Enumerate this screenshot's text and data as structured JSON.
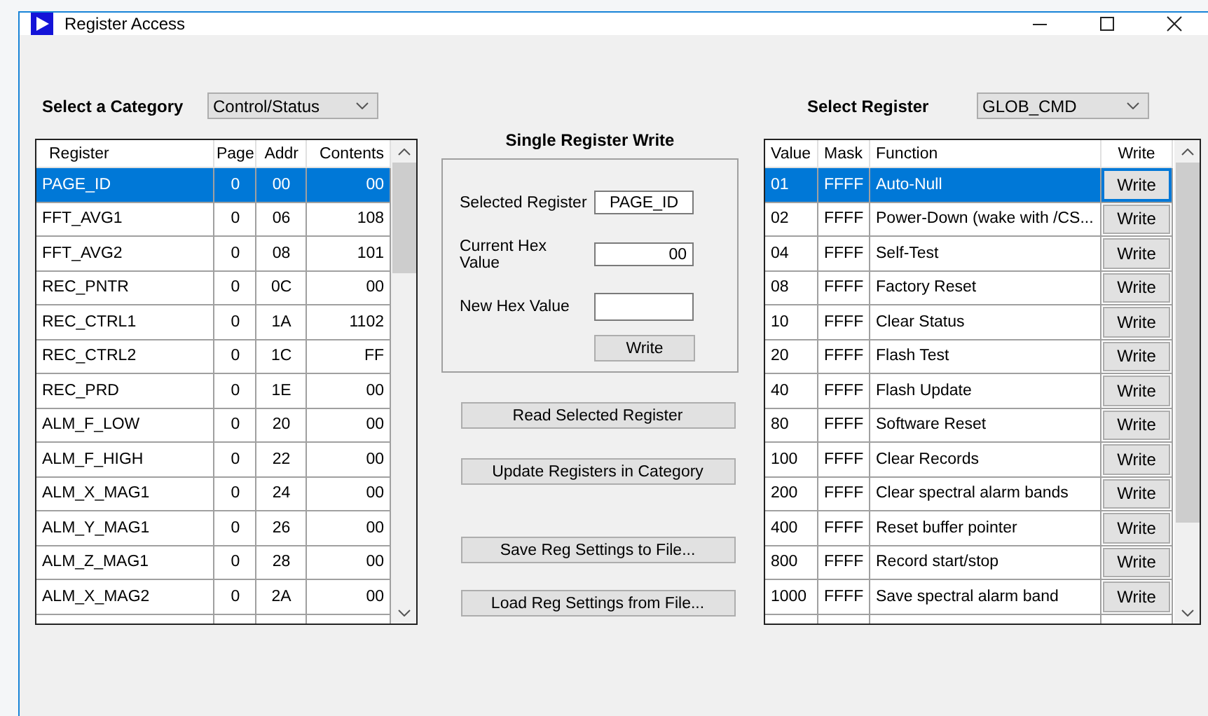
{
  "window": {
    "title": "Register Access"
  },
  "category": {
    "label": "Select a Category",
    "value": "Control/Status"
  },
  "registers": {
    "columns": [
      "Register",
      "Page",
      "Addr",
      "Contents"
    ],
    "rows": [
      {
        "register": "PAGE_ID",
        "page": "0",
        "addr": "00",
        "contents": "00",
        "selected": true
      },
      {
        "register": "FFT_AVG1",
        "page": "0",
        "addr": "06",
        "contents": "108",
        "selected": false
      },
      {
        "register": "FFT_AVG2",
        "page": "0",
        "addr": "08",
        "contents": "101",
        "selected": false
      },
      {
        "register": "REC_PNTR",
        "page": "0",
        "addr": "0C",
        "contents": "00",
        "selected": false
      },
      {
        "register": "REC_CTRL1",
        "page": "0",
        "addr": "1A",
        "contents": "1102",
        "selected": false
      },
      {
        "register": "REC_CTRL2",
        "page": "0",
        "addr": "1C",
        "contents": "FF",
        "selected": false
      },
      {
        "register": "REC_PRD",
        "page": "0",
        "addr": "1E",
        "contents": "00",
        "selected": false
      },
      {
        "register": "ALM_F_LOW",
        "page": "0",
        "addr": "20",
        "contents": "00",
        "selected": false
      },
      {
        "register": "ALM_F_HIGH",
        "page": "0",
        "addr": "22",
        "contents": "00",
        "selected": false
      },
      {
        "register": "ALM_X_MAG1",
        "page": "0",
        "addr": "24",
        "contents": "00",
        "selected": false
      },
      {
        "register": "ALM_Y_MAG1",
        "page": "0",
        "addr": "26",
        "contents": "00",
        "selected": false
      },
      {
        "register": "ALM_Z_MAG1",
        "page": "0",
        "addr": "28",
        "contents": "00",
        "selected": false
      },
      {
        "register": "ALM_X_MAG2",
        "page": "0",
        "addr": "2A",
        "contents": "00",
        "selected": false
      }
    ]
  },
  "single_write": {
    "title": "Single Register Write",
    "fields": [
      {
        "label": "Selected Register",
        "value": "PAGE_ID"
      },
      {
        "label": "Current Hex Value",
        "value": "00"
      },
      {
        "label": "New Hex Value"
      }
    ],
    "button": "Write"
  },
  "actions": [
    "Read Selected Register",
    "Update Registers in Category",
    "Save Reg Settings to File...",
    "Load Reg Settings from File..."
  ],
  "select_register": {
    "label": "Select Register",
    "value": "GLOB_CMD"
  },
  "functions": {
    "columns": [
      "Value",
      "Mask",
      "Function",
      "Write"
    ],
    "rows": [
      {
        "value": "01",
        "mask": "FFFF",
        "function": "Auto-Null",
        "button": "Write",
        "selected": true
      },
      {
        "value": "02",
        "mask": "FFFF",
        "function": "Power-Down (wake with /CS...",
        "button": "Write",
        "selected": false
      },
      {
        "value": "04",
        "mask": "FFFF",
        "function": "Self-Test",
        "button": "Write",
        "selected": false
      },
      {
        "value": "08",
        "mask": "FFFF",
        "function": "Factory Reset",
        "button": "Write",
        "selected": false
      },
      {
        "value": "10",
        "mask": "FFFF",
        "function": "Clear Status",
        "button": "Write",
        "selected": false
      },
      {
        "value": "20",
        "mask": "FFFF",
        "function": "Flash Test",
        "button": "Write",
        "selected": false
      },
      {
        "value": "40",
        "mask": "FFFF",
        "function": "Flash Update",
        "button": "Write",
        "selected": false
      },
      {
        "value": "80",
        "mask": "FFFF",
        "function": "Software Reset",
        "button": "Write",
        "selected": false
      },
      {
        "value": "100",
        "mask": "FFFF",
        "function": "Clear Records",
        "button": "Write",
        "selected": false
      },
      {
        "value": "200",
        "mask": "FFFF",
        "function": "Clear spectral alarm bands",
        "button": "Write",
        "selected": false
      },
      {
        "value": "400",
        "mask": "FFFF",
        "function": "Reset buffer pointer",
        "button": "Write",
        "selected": false
      },
      {
        "value": "800",
        "mask": "FFFF",
        "function": "Record start/stop",
        "button": "Write",
        "selected": false
      },
      {
        "value": "1000",
        "mask": "FFFF",
        "function": "Save spectral alarm band",
        "button": "Write",
        "selected": false
      }
    ]
  }
}
